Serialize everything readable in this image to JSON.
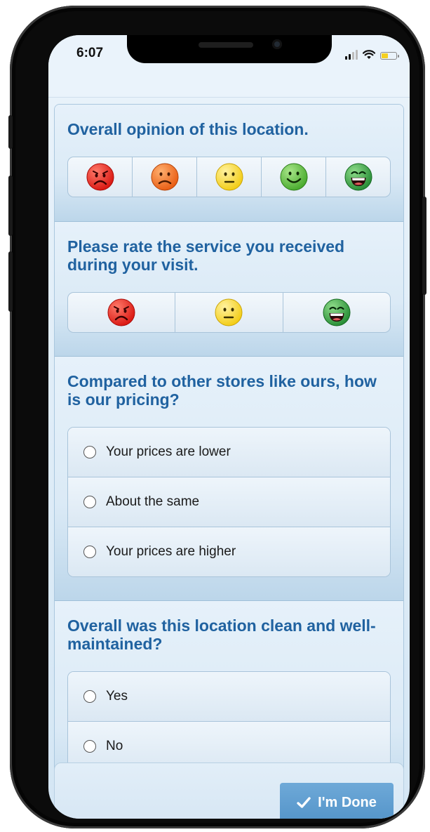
{
  "status_bar": {
    "time": "6:07",
    "icons": [
      "signal-icon",
      "wifi-icon",
      "battery-icon"
    ]
  },
  "questions": [
    {
      "title": "Overall opinion of this location.",
      "type": "rating",
      "options": [
        "very-sad-face-icon",
        "sad-face-icon",
        "neutral-face-icon",
        "happy-face-icon",
        "very-happy-face-icon"
      ]
    },
    {
      "title": "Please rate the service you received during your visit.",
      "type": "rating",
      "options": [
        "very-sad-face-icon",
        "neutral-face-icon",
        "very-happy-face-icon"
      ]
    },
    {
      "title": "Compared to other stores like ours, how is our pricing?",
      "type": "radio",
      "options": [
        "Your prices are lower",
        "About the same",
        "Your prices are higher"
      ]
    },
    {
      "title": "Overall was this location clean and well-maintained?",
      "type": "radio",
      "options": [
        "Yes",
        "No"
      ]
    }
  ],
  "footer": {
    "done_label": "I'm Done"
  },
  "colors": {
    "question_title": "#2062a0",
    "done_button": "#5a9bd0",
    "face_red": "#e0231f",
    "face_orange": "#f06a1a",
    "face_yellow": "#f7d81f",
    "face_green": "#52b531",
    "face_dark_green": "#2f9a3a"
  }
}
